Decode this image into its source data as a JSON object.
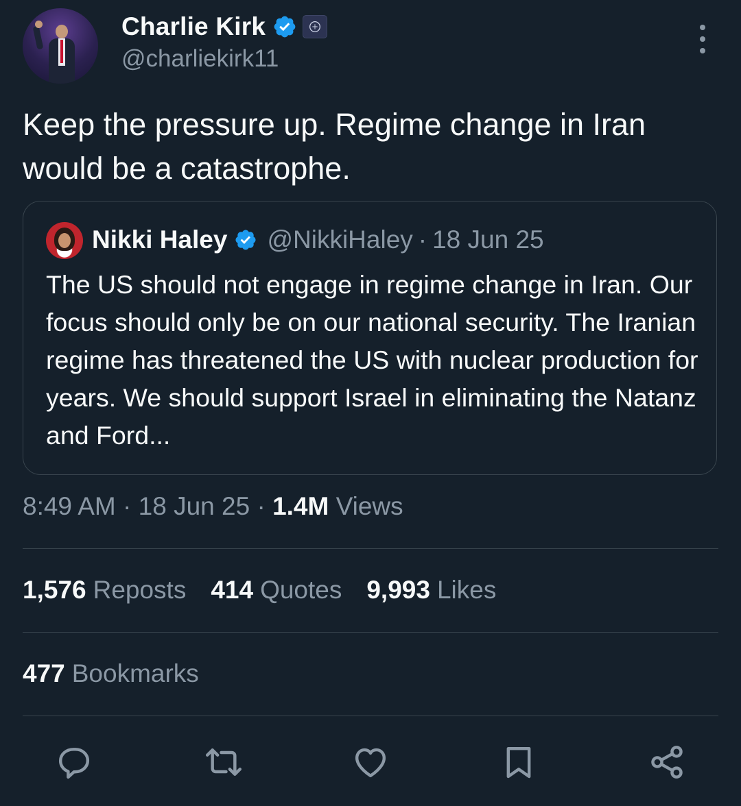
{
  "author": {
    "display_name": "Charlie Kirk",
    "handle": "@charliekirk11",
    "verified": true,
    "affiliate_badge_icon": "organization-badge-icon"
  },
  "tweet": {
    "text": "Keep the pressure up. Regime change in Iran would be a catastrophe."
  },
  "quoted_tweet": {
    "display_name": "Nikki Haley",
    "handle": "@NikkiHaley",
    "separator": "·",
    "date": "18 Jun 25",
    "verified": true,
    "text": "The US should not engage in regime change in Iran. Our focus should only be on our national security. The Iranian regime has threatened the US with nuclear production for years. We should support Israel in eliminating the Natanz and Ford..."
  },
  "meta": {
    "time": "8:49 AM",
    "sep1": "·",
    "date": "18 Jun 25",
    "sep2": "·",
    "views_count": "1.4M",
    "views_label": "Views"
  },
  "stats": {
    "reposts_count": "1,576",
    "reposts_label": "Reposts",
    "quotes_count": "414",
    "quotes_label": "Quotes",
    "likes_count": "9,993",
    "likes_label": "Likes",
    "bookmarks_count": "477",
    "bookmarks_label": "Bookmarks"
  },
  "actions": [
    "reply-icon",
    "repost-icon",
    "like-icon",
    "bookmark-icon",
    "share-icon"
  ],
  "colors": {
    "background": "#15202b",
    "text_primary": "#f7f9f9",
    "text_secondary": "#8b98a5",
    "border": "#38444d",
    "verified_blue": "#1d9bf0"
  }
}
